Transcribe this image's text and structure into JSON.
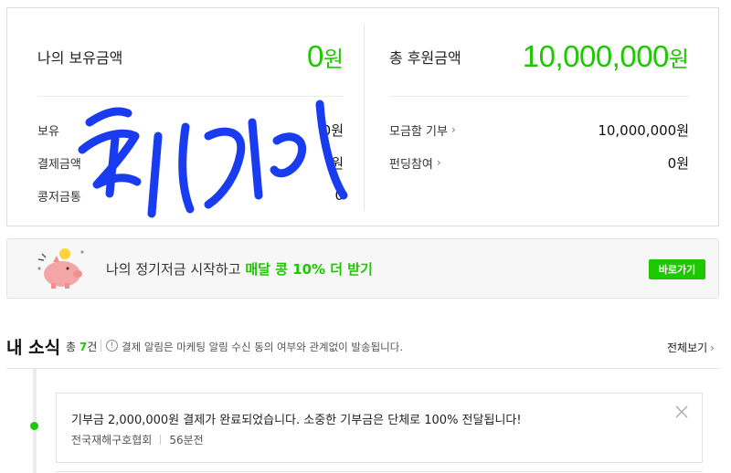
{
  "summary": {
    "my_balance": {
      "label": "나의 보유금액",
      "amount": "0",
      "unit": "원"
    },
    "left_rows": [
      {
        "label": "보유",
        "value": "0원"
      },
      {
        "label": "결제금액",
        "value": "원"
      },
      {
        "label": "콩저금통",
        "value": "0"
      }
    ],
    "total_donation": {
      "label": "총 후원금액",
      "amount": "10,000,000",
      "unit": "원"
    },
    "right_rows": [
      {
        "label": "모금함 기부",
        "value": "10,000,000원"
      },
      {
        "label": "펀딩참여",
        "value": "0원"
      }
    ]
  },
  "banner": {
    "text_plain": "나의 정기저금 시작하고 ",
    "text_highlight": "매달 콩 10% 더 받기",
    "button_label": "바로가기"
  },
  "news": {
    "title": "내 소식",
    "count_prefix": "총 ",
    "count_value": "7",
    "count_suffix": "건",
    "info_icon_glyph": "!",
    "note": "결제 알림은 마케팅 알림 수신 동의 여부와 관계없이 발송됩니다.",
    "see_all_label": "전체보기",
    "items": [
      {
        "message": "기부금 2,000,000원 결제가 완료되었습니다. 소중한 기부금은 단체로 100% 전달됩니다!",
        "org": "전국재해구호협회",
        "time": "56분전"
      }
    ]
  },
  "colors": {
    "accent": "#1ec800",
    "scribble": "#1a3cf0"
  },
  "icons": [
    "chevron-right-icon",
    "piggy-bank-icon",
    "info-icon",
    "close-icon"
  ]
}
